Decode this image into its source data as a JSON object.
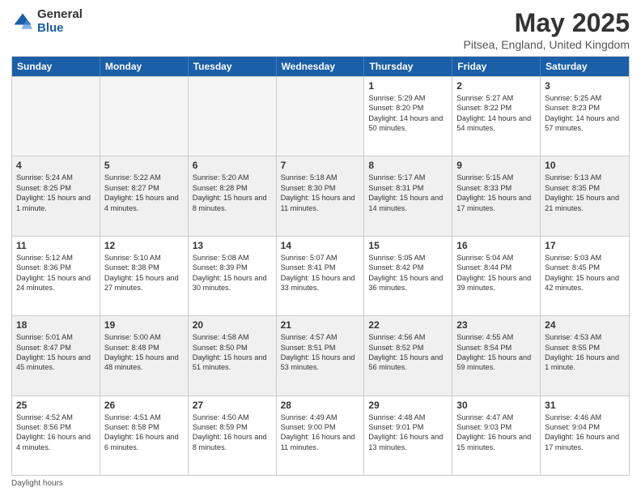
{
  "logo": {
    "general": "General",
    "blue": "Blue"
  },
  "title": "May 2025",
  "subtitle": "Pitsea, England, United Kingdom",
  "days_of_week": [
    "Sunday",
    "Monday",
    "Tuesday",
    "Wednesday",
    "Thursday",
    "Friday",
    "Saturday"
  ],
  "weeks": [
    [
      {
        "day": "",
        "empty": true
      },
      {
        "day": "",
        "empty": true
      },
      {
        "day": "",
        "empty": true
      },
      {
        "day": "",
        "empty": true
      },
      {
        "day": "1",
        "sunrise": "5:29 AM",
        "sunset": "8:20 PM",
        "daylight": "14 hours and 50 minutes."
      },
      {
        "day": "2",
        "sunrise": "5:27 AM",
        "sunset": "8:22 PM",
        "daylight": "14 hours and 54 minutes."
      },
      {
        "day": "3",
        "sunrise": "5:25 AM",
        "sunset": "8:23 PM",
        "daylight": "14 hours and 57 minutes."
      }
    ],
    [
      {
        "day": "4",
        "sunrise": "5:24 AM",
        "sunset": "8:25 PM",
        "daylight": "15 hours and 1 minute."
      },
      {
        "day": "5",
        "sunrise": "5:22 AM",
        "sunset": "8:27 PM",
        "daylight": "15 hours and 4 minutes."
      },
      {
        "day": "6",
        "sunrise": "5:20 AM",
        "sunset": "8:28 PM",
        "daylight": "15 hours and 8 minutes."
      },
      {
        "day": "7",
        "sunrise": "5:18 AM",
        "sunset": "8:30 PM",
        "daylight": "15 hours and 11 minutes."
      },
      {
        "day": "8",
        "sunrise": "5:17 AM",
        "sunset": "8:31 PM",
        "daylight": "15 hours and 14 minutes."
      },
      {
        "day": "9",
        "sunrise": "5:15 AM",
        "sunset": "8:33 PM",
        "daylight": "15 hours and 17 minutes."
      },
      {
        "day": "10",
        "sunrise": "5:13 AM",
        "sunset": "8:35 PM",
        "daylight": "15 hours and 21 minutes."
      }
    ],
    [
      {
        "day": "11",
        "sunrise": "5:12 AM",
        "sunset": "8:36 PM",
        "daylight": "15 hours and 24 minutes."
      },
      {
        "day": "12",
        "sunrise": "5:10 AM",
        "sunset": "8:38 PM",
        "daylight": "15 hours and 27 minutes."
      },
      {
        "day": "13",
        "sunrise": "5:08 AM",
        "sunset": "8:39 PM",
        "daylight": "15 hours and 30 minutes."
      },
      {
        "day": "14",
        "sunrise": "5:07 AM",
        "sunset": "8:41 PM",
        "daylight": "15 hours and 33 minutes."
      },
      {
        "day": "15",
        "sunrise": "5:05 AM",
        "sunset": "8:42 PM",
        "daylight": "15 hours and 36 minutes."
      },
      {
        "day": "16",
        "sunrise": "5:04 AM",
        "sunset": "8:44 PM",
        "daylight": "15 hours and 39 minutes."
      },
      {
        "day": "17",
        "sunrise": "5:03 AM",
        "sunset": "8:45 PM",
        "daylight": "15 hours and 42 minutes."
      }
    ],
    [
      {
        "day": "18",
        "sunrise": "5:01 AM",
        "sunset": "8:47 PM",
        "daylight": "15 hours and 45 minutes."
      },
      {
        "day": "19",
        "sunrise": "5:00 AM",
        "sunset": "8:48 PM",
        "daylight": "15 hours and 48 minutes."
      },
      {
        "day": "20",
        "sunrise": "4:58 AM",
        "sunset": "8:50 PM",
        "daylight": "15 hours and 51 minutes."
      },
      {
        "day": "21",
        "sunrise": "4:57 AM",
        "sunset": "8:51 PM",
        "daylight": "15 hours and 53 minutes."
      },
      {
        "day": "22",
        "sunrise": "4:56 AM",
        "sunset": "8:52 PM",
        "daylight": "15 hours and 56 minutes."
      },
      {
        "day": "23",
        "sunrise": "4:55 AM",
        "sunset": "8:54 PM",
        "daylight": "15 hours and 59 minutes."
      },
      {
        "day": "24",
        "sunrise": "4:53 AM",
        "sunset": "8:55 PM",
        "daylight": "16 hours and 1 minute."
      }
    ],
    [
      {
        "day": "25",
        "sunrise": "4:52 AM",
        "sunset": "8:56 PM",
        "daylight": "16 hours and 4 minutes."
      },
      {
        "day": "26",
        "sunrise": "4:51 AM",
        "sunset": "8:58 PM",
        "daylight": "16 hours and 6 minutes."
      },
      {
        "day": "27",
        "sunrise": "4:50 AM",
        "sunset": "8:59 PM",
        "daylight": "16 hours and 8 minutes."
      },
      {
        "day": "28",
        "sunrise": "4:49 AM",
        "sunset": "9:00 PM",
        "daylight": "16 hours and 11 minutes."
      },
      {
        "day": "29",
        "sunrise": "4:48 AM",
        "sunset": "9:01 PM",
        "daylight": "16 hours and 13 minutes."
      },
      {
        "day": "30",
        "sunrise": "4:47 AM",
        "sunset": "9:03 PM",
        "daylight": "16 hours and 15 minutes."
      },
      {
        "day": "31",
        "sunrise": "4:46 AM",
        "sunset": "9:04 PM",
        "daylight": "16 hours and 17 minutes."
      }
    ]
  ],
  "footer": {
    "daylight_label": "Daylight hours"
  },
  "labels": {
    "sunrise_prefix": "Sunrise: ",
    "sunset_prefix": "Sunset: ",
    "daylight_prefix": "Daylight: "
  }
}
